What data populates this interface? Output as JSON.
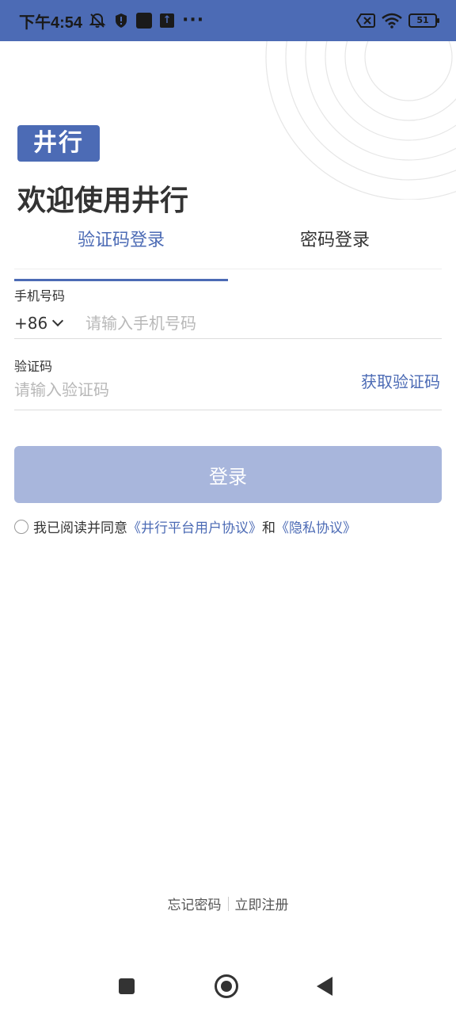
{
  "status_bar": {
    "time": "下午4:54",
    "battery": "51",
    "bg_color": "#4c6bb5"
  },
  "logo": {
    "text": "井行"
  },
  "welcome": "欢迎使用井行",
  "tabs": [
    {
      "label": "验证码登录",
      "active": true
    },
    {
      "label": "密码登录",
      "active": false
    }
  ],
  "phone": {
    "label": "手机号码",
    "country_code": "+86",
    "placeholder": "请输入手机号码"
  },
  "code": {
    "label": "验证码",
    "placeholder": "请输入验证码",
    "get_code": "获取验证码"
  },
  "login_button": "登录",
  "agreement": {
    "prefix": "我已阅读并同意",
    "terms": "《井行平台用户协议》",
    "and": "和",
    "privacy": "《隐私协议》"
  },
  "bottom": {
    "forgot": "忘记密码",
    "register": "立即注册"
  },
  "colors": {
    "accent": "#4c6bb5",
    "button_disabled": "#a8b6dc"
  }
}
